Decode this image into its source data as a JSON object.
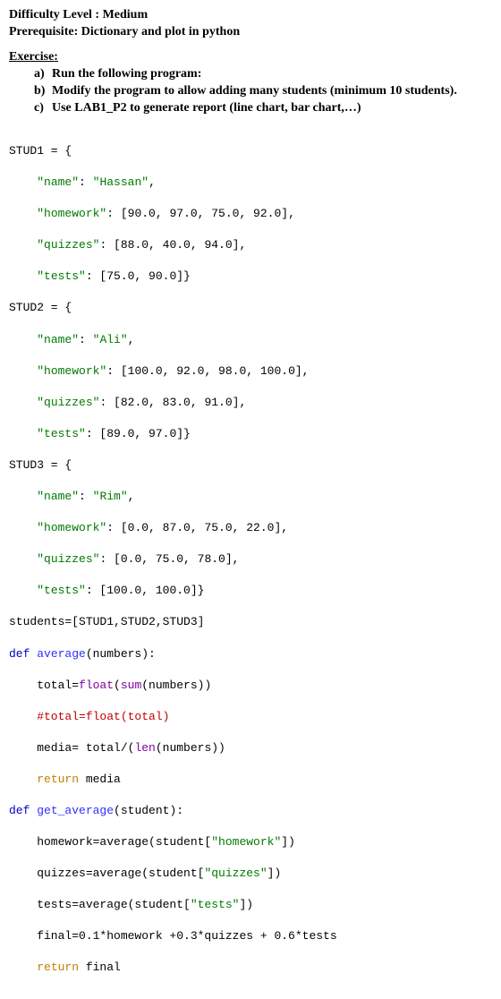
{
  "header": {
    "difficulty": "Difficulty Level : Medium",
    "prerequisite": "Prerequisite: Dictionary and plot in python"
  },
  "exercise": {
    "label": "Exercise",
    "items": [
      {
        "letter": "a)",
        "text": "Run the following program:"
      },
      {
        "letter": "b)",
        "text": "Modify the program to allow adding many students (minimum 10 students)."
      },
      {
        "letter": "c)",
        "text": "Use LAB1_P2 to generate report (line chart, bar chart,…)"
      }
    ]
  },
  "code": {
    "l01": "STUD1 = {",
    "l02a": "    ",
    "l02b": "\"name\"",
    "l02c": ": ",
    "l02d": "\"Hassan\"",
    "l02e": ",",
    "l03a": "    ",
    "l03b": "\"homework\"",
    "l03c": ": [90.0, 97.0, 75.0, 92.0],",
    "l04a": "    ",
    "l04b": "\"quizzes\"",
    "l04c": ": [88.0, 40.0, 94.0],",
    "l05a": "    ",
    "l05b": "\"tests\"",
    "l05c": ": [75.0, 90.0]}",
    "l06": "STUD2 = {",
    "l07a": "    ",
    "l07b": "\"name\"",
    "l07c": ": ",
    "l07d": "\"Ali\"",
    "l07e": ",",
    "l08a": "    ",
    "l08b": "\"homework\"",
    "l08c": ": [100.0, 92.0, 98.0, 100.0],",
    "l09a": "    ",
    "l09b": "\"quizzes\"",
    "l09c": ": [82.0, 83.0, 91.0],",
    "l10a": "    ",
    "l10b": "\"tests\"",
    "l10c": ": [89.0, 97.0]}",
    "l11": "STUD3 = {",
    "l12a": "    ",
    "l12b": "\"name\"",
    "l12c": ": ",
    "l12d": "\"Rim\"",
    "l12e": ",",
    "l13a": "    ",
    "l13b": "\"homework\"",
    "l13c": ": [0.0, 87.0, 75.0, 22.0],",
    "l14a": "    ",
    "l14b": "\"quizzes\"",
    "l14c": ": [0.0, 75.0, 78.0],",
    "l15a": "    ",
    "l15b": "\"tests\"",
    "l15c": ": [100.0, 100.0]}",
    "l16": "students=[STUD1,STUD2,STUD3]",
    "l17a": "def",
    "l17b": " ",
    "l17c": "average",
    "l17d": "(numbers):",
    "l18a": "    total=",
    "l18b": "float",
    "l18c": "(",
    "l18d": "sum",
    "l18e": "(numbers))",
    "l19": "    #total=float(total)",
    "l20a": "    media= total/(",
    "l20b": "len",
    "l20c": "(numbers))",
    "l21a": "    ",
    "l21b": "return",
    "l21c": " media",
    "l22a": "def",
    "l22b": " ",
    "l22c": "get_average",
    "l22d": "(student):",
    "l23a": "    homework=average(student[",
    "l23b": "\"homework\"",
    "l23c": "])",
    "l24a": "    quizzes=average(student[",
    "l24b": "\"quizzes\"",
    "l24c": "])",
    "l25a": "    tests=average(student[",
    "l25b": "\"tests\"",
    "l25c": "])",
    "l26": "    final=0.1*homework +0.3*quizzes + 0.6*tests",
    "l27a": "    ",
    "l27b": "return",
    "l27c": " final"
  }
}
